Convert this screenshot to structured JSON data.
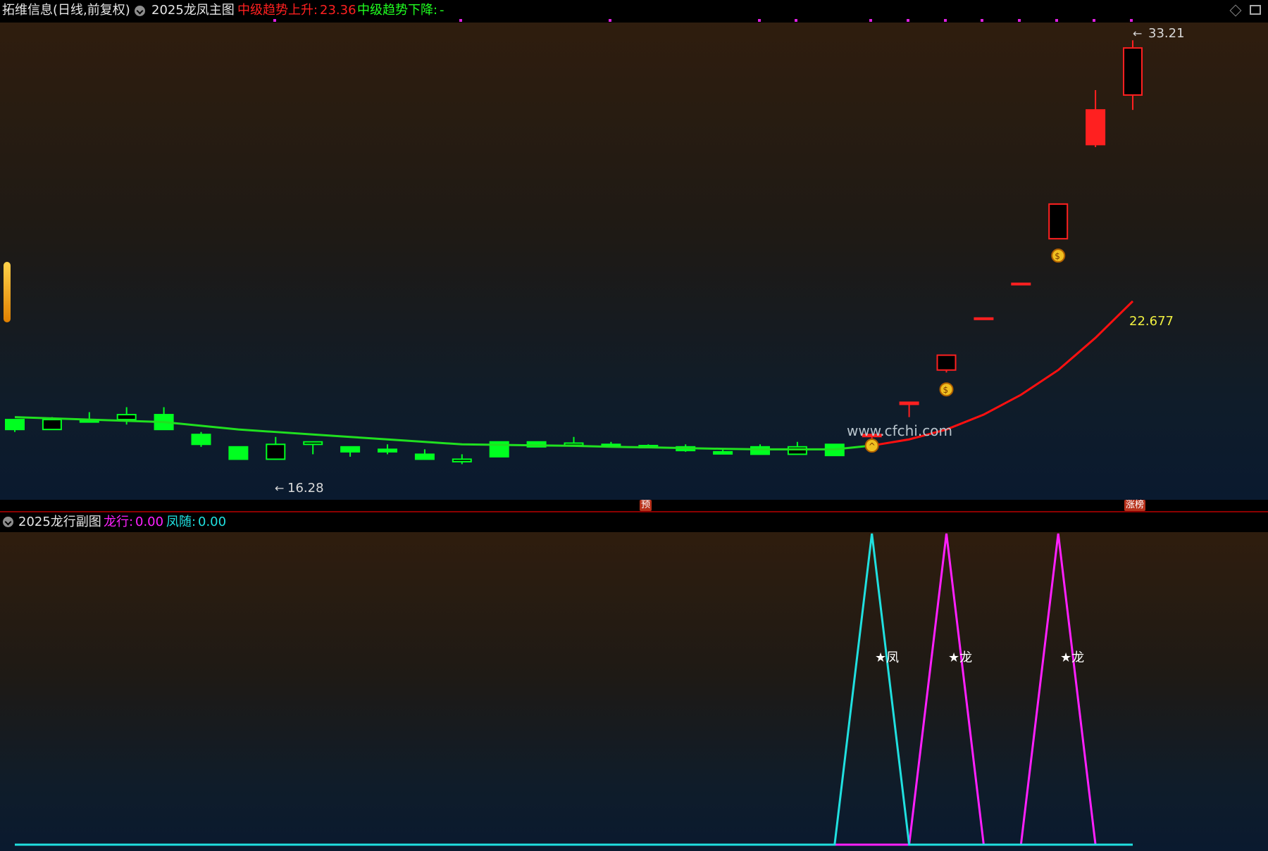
{
  "header": {
    "stock": "拓维信息(日线,前复权)",
    "indicator": "2025龙凤主图",
    "up_label": "中级趋势上升:",
    "up_value": "23.36",
    "down_label": "中级趋势下降:",
    "down_value": "-"
  },
  "main_chart": {
    "low_label": "16.28",
    "high_label": "33.21",
    "ma_label": "22.677",
    "watermark": "www.cfchi.com",
    "markers": {
      "pre": "预",
      "limit": "涨榜"
    }
  },
  "sub_header": {
    "indicator": "2025龙行副图",
    "long_label": "龙行:",
    "long_value": "0.00",
    "feng_label": "凤随:",
    "feng_value": "0.00"
  },
  "sub_chart": {
    "labels": [
      "★凤",
      "★龙",
      "★龙"
    ]
  },
  "colors": {
    "up": "#ff2020",
    "down": "#00ff20",
    "cyan": "#20e0e0",
    "magenta": "#ff20ff",
    "ma_label": "#f0f040"
  },
  "chart_data": {
    "type": "candlestick",
    "candles": [
      {
        "o": 17.9,
        "c": 17.5,
        "h": 17.9,
        "l": 17.4
      },
      {
        "o": 17.5,
        "c": 17.9,
        "h": 18.0,
        "l": 17.5
      },
      {
        "o": 17.9,
        "c": 17.8,
        "h": 18.2,
        "l": 17.8
      },
      {
        "o": 17.9,
        "c": 18.1,
        "h": 18.4,
        "l": 17.7
      },
      {
        "o": 18.1,
        "c": 17.5,
        "h": 18.4,
        "l": 17.5
      },
      {
        "o": 17.3,
        "c": 16.9,
        "h": 17.4,
        "l": 16.8
      },
      {
        "o": 16.8,
        "c": 16.3,
        "h": 16.8,
        "l": 16.3
      },
      {
        "o": 16.3,
        "c": 16.9,
        "h": 17.2,
        "l": 16.28
      },
      {
        "o": 16.9,
        "c": 17.0,
        "h": 17.0,
        "l": 16.5
      },
      {
        "o": 16.8,
        "c": 16.6,
        "h": 16.8,
        "l": 16.4
      },
      {
        "o": 16.7,
        "c": 16.6,
        "h": 16.9,
        "l": 16.5
      },
      {
        "o": 16.5,
        "c": 16.3,
        "h": 16.7,
        "l": 16.3
      },
      {
        "o": 16.2,
        "c": 16.3,
        "h": 16.5,
        "l": 16.1
      },
      {
        "o": 17.0,
        "c": 16.4,
        "h": 17.0,
        "l": 16.4
      },
      {
        "o": 17.0,
        "c": 16.8,
        "h": 17.0,
        "l": 16.8
      },
      {
        "o": 16.9,
        "c": 16.95,
        "h": 17.2,
        "l": 16.9
      },
      {
        "o": 16.9,
        "c": 16.9,
        "h": 17.0,
        "l": 16.8
      },
      {
        "o": 16.85,
        "c": 16.8,
        "h": 16.9,
        "l": 16.75
      },
      {
        "o": 16.8,
        "c": 16.65,
        "h": 16.9,
        "l": 16.6
      },
      {
        "o": 16.6,
        "c": 16.6,
        "h": 16.7,
        "l": 16.5
      },
      {
        "o": 16.8,
        "c": 16.5,
        "h": 16.9,
        "l": 16.5
      },
      {
        "o": 16.5,
        "c": 16.8,
        "h": 17.0,
        "l": 16.5
      },
      {
        "o": 16.9,
        "c": 16.45,
        "h": 16.9,
        "l": 16.45
      },
      {
        "o": 17.3,
        "c": 17.3,
        "h": 17.3,
        "l": 17.0
      },
      {
        "o": 18.6,
        "c": 18.6,
        "h": 18.6,
        "l": 18.0
      },
      {
        "o": 19.9,
        "c": 20.5,
        "h": 20.5,
        "l": 19.8
      },
      {
        "o": 22.0,
        "c": 22.0,
        "h": 22.0,
        "l": 22.0
      },
      {
        "o": 23.4,
        "c": 23.4,
        "h": 23.4,
        "l": 23.4
      },
      {
        "o": 25.2,
        "c": 26.6,
        "h": 26.6,
        "l": 25.2
      },
      {
        "o": 30.4,
        "c": 29.0,
        "h": 31.2,
        "l": 28.9
      },
      {
        "o": 31.0,
        "c": 32.9,
        "h": 33.21,
        "l": 30.4
      }
    ],
    "ma": [
      18.0,
      17.95,
      17.9,
      17.85,
      17.8,
      17.65,
      17.5,
      17.4,
      17.3,
      17.2,
      17.1,
      17.0,
      16.9,
      16.88,
      16.86,
      16.84,
      16.8,
      16.78,
      16.75,
      16.72,
      16.7,
      16.7,
      16.7,
      16.85,
      17.1,
      17.5,
      18.1,
      18.9,
      19.9,
      21.2,
      22.677
    ],
    "ylim": [
      15.8,
      33.7
    ]
  },
  "sub_chart_data": {
    "type": "line",
    "series": [
      {
        "name": "凤随",
        "values": [
          0,
          0,
          0,
          0,
          0,
          0,
          0,
          0,
          0,
          0,
          0,
          0,
          0,
          0,
          0,
          0,
          0,
          0,
          0,
          0,
          0,
          0,
          0,
          1,
          0,
          0,
          0,
          0,
          0,
          0,
          0
        ]
      },
      {
        "name": "龙行",
        "values": [
          0,
          0,
          0,
          0,
          0,
          0,
          0,
          0,
          0,
          0,
          0,
          0,
          0,
          0,
          0,
          0,
          0,
          0,
          0,
          0,
          0,
          0,
          0,
          0,
          0,
          1,
          0,
          0,
          1,
          0,
          0
        ]
      }
    ],
    "ylim": [
      0,
      1
    ]
  }
}
